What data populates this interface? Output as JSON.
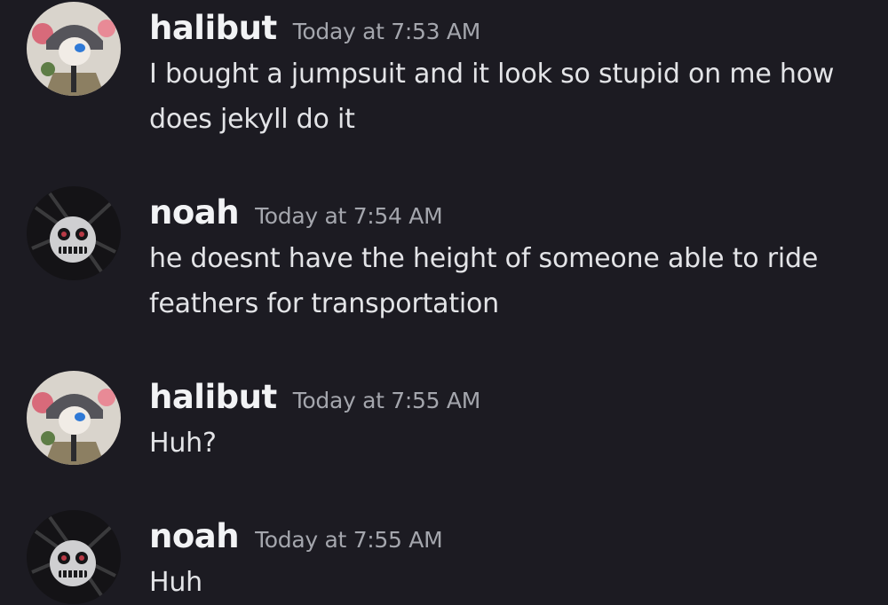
{
  "messages": [
    {
      "author": "halibut",
      "timestamp": "Today at 7:53 AM",
      "text": "I bought a jumpsuit and it look so stupid on me how does jekyll do it",
      "avatar": "halibut-avatar-icon"
    },
    {
      "author": "noah",
      "timestamp": "Today at 7:54 AM",
      "text": "he doesnt have the height of someone able to ride feathers for transportation",
      "avatar": "noah-avatar-icon"
    },
    {
      "author": "halibut",
      "timestamp": "Today at 7:55 AM",
      "text": "Huh?",
      "avatar": "halibut-avatar-icon"
    },
    {
      "author": "noah",
      "timestamp": "Today at 7:55 AM",
      "text": "Huh",
      "avatar": "noah-avatar-icon"
    }
  ],
  "colors": {
    "background": "#1c1b22",
    "username": "#f2f3f5",
    "timestamp": "#a4a6ad",
    "message_text": "#e3e4e7"
  }
}
